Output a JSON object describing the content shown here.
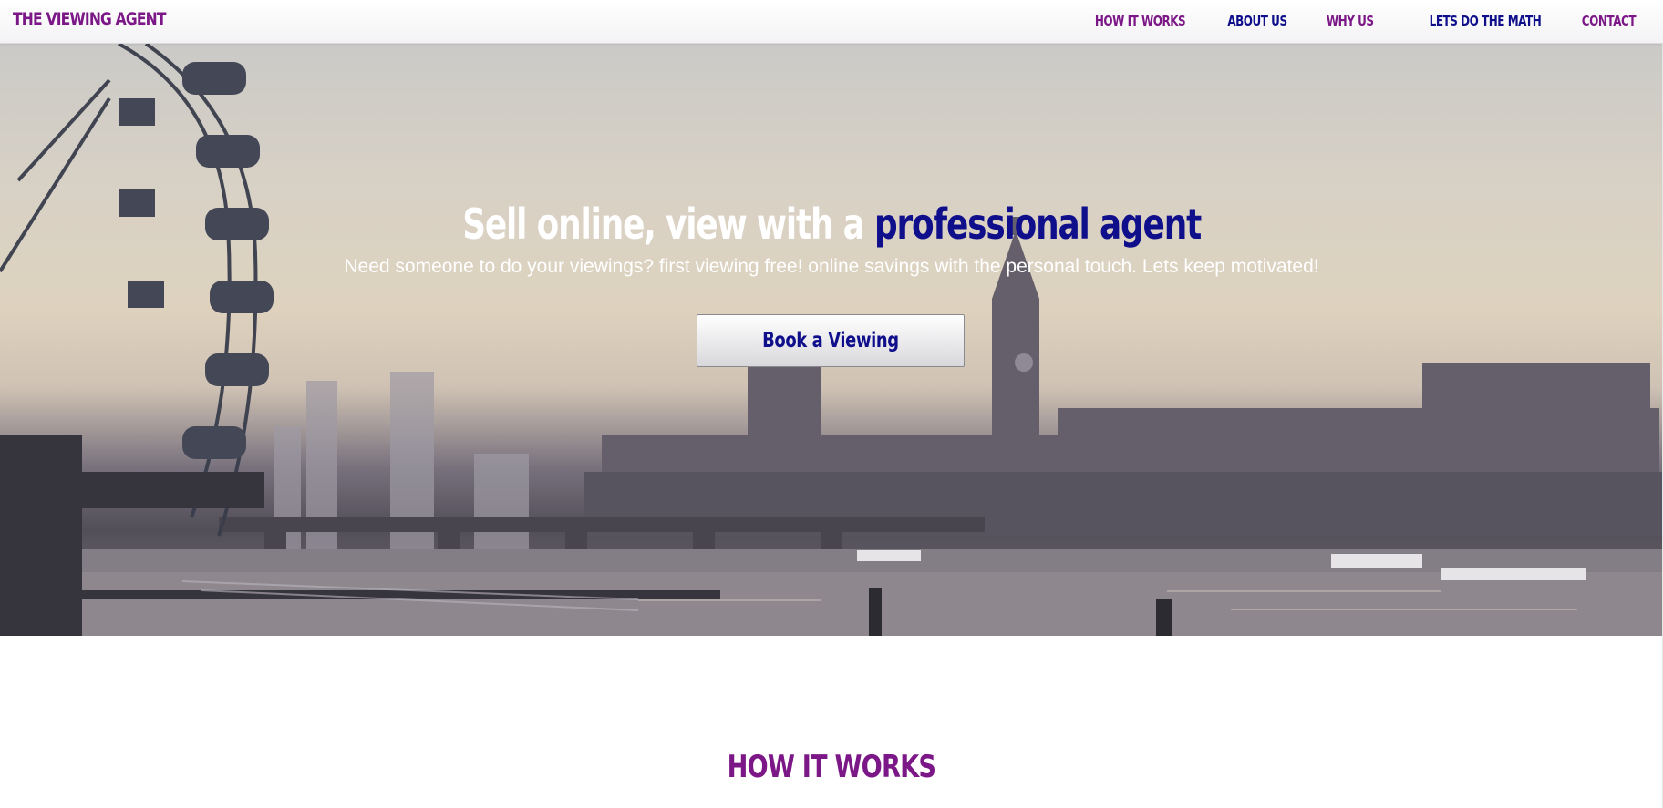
{
  "brand": {
    "name": "THE VIEWING AGENT"
  },
  "nav": {
    "items": [
      {
        "label": "HOW IT WORKS"
      },
      {
        "label": "ABOUT US"
      },
      {
        "label": "WHY US"
      },
      {
        "label": "LETS DO THE MATH"
      },
      {
        "label": "CONTACT"
      }
    ]
  },
  "hero": {
    "title_part1": "Sell online, view with a ",
    "title_part2": "professional agent",
    "subtitle": "Need someone to do your viewings? first viewing free! online savings with the personal touch. Lets keep motivated!",
    "cta_label": "Book a Viewing"
  },
  "sections": {
    "how_it_works_title": "HOW IT WORKS"
  },
  "colors": {
    "purple": "#7b1786",
    "navy": "#0f0f8c",
    "white": "#ffffff"
  }
}
